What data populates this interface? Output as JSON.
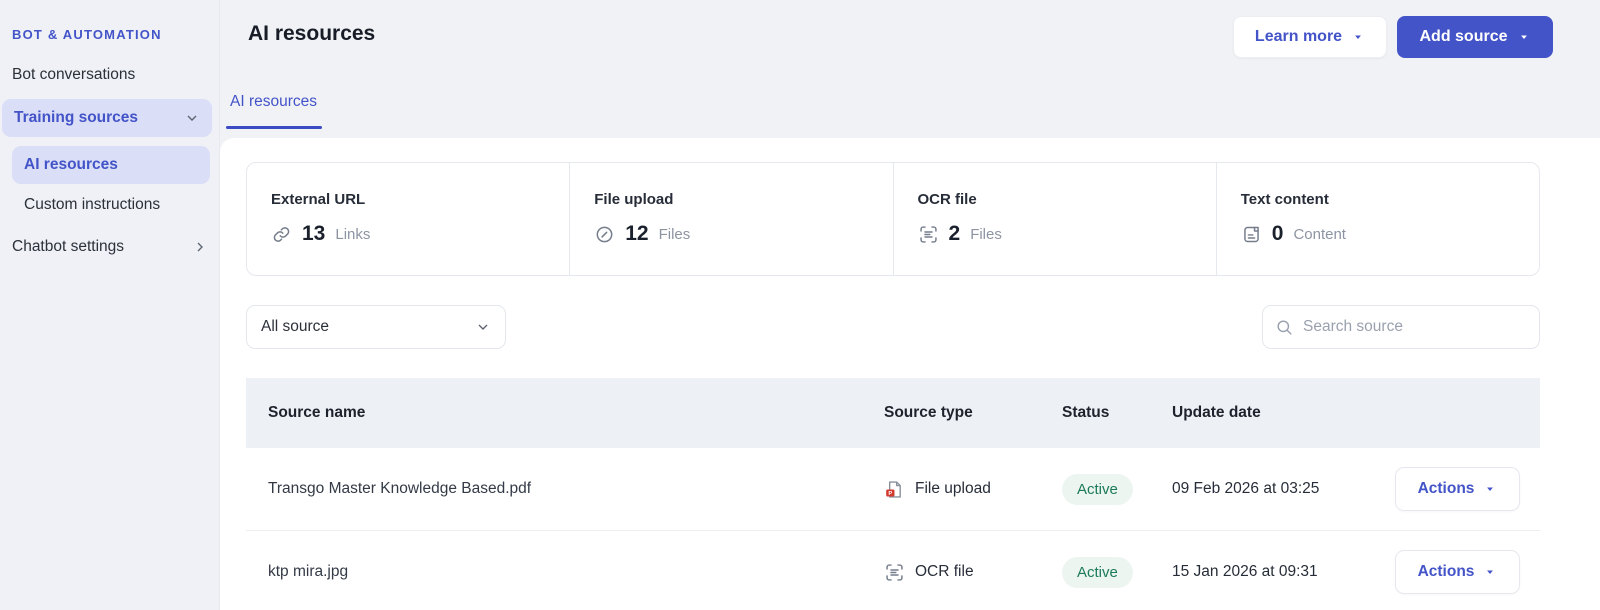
{
  "sidebar": {
    "section_label": "BOT & AUTOMATION",
    "bot_conversations": "Bot conversations",
    "training_sources": "Training sources",
    "ai_resources": "AI resources",
    "custom_instructions": "Custom instructions",
    "chatbot_settings": "Chatbot settings"
  },
  "header": {
    "title": "AI resources",
    "learn_more_label": "Learn more",
    "add_source_label": "Add source"
  },
  "tabs": {
    "active_label": "AI resources"
  },
  "stats": {
    "items": [
      {
        "label": "External URL",
        "value": "13",
        "unit": "Links",
        "icon": "link-icon"
      },
      {
        "label": "File upload",
        "value": "12",
        "unit": "Files",
        "icon": "paperclip-icon"
      },
      {
        "label": "OCR file",
        "value": "2",
        "unit": "Files",
        "icon": "ocr-scan-icon"
      },
      {
        "label": "Text content",
        "value": "0",
        "unit": "Content",
        "icon": "text-document-icon"
      }
    ]
  },
  "filters": {
    "source_select_value": "All source",
    "search_placeholder": "Search source"
  },
  "table": {
    "columns": [
      "Source name",
      "Source type",
      "Status",
      "Update date"
    ],
    "actions_label": "Actions",
    "rows": [
      {
        "name": "Transgo Master Knowledge Based.pdf",
        "type": "File upload",
        "type_icon": "pdf-file-icon",
        "status": "Active",
        "updated": "09 Feb 2026 at 03:25"
      },
      {
        "name": "ktp mira.jpg",
        "type": "OCR file",
        "type_icon": "ocr-scan-icon",
        "status": "Active",
        "updated": "15 Jan 2026 at 09:31"
      }
    ]
  },
  "colors": {
    "accent": "#4353c8",
    "accent_light_bg": "#dadef7",
    "status_active_bg": "#ecf5f0",
    "status_active_text": "#1d7a5c"
  }
}
